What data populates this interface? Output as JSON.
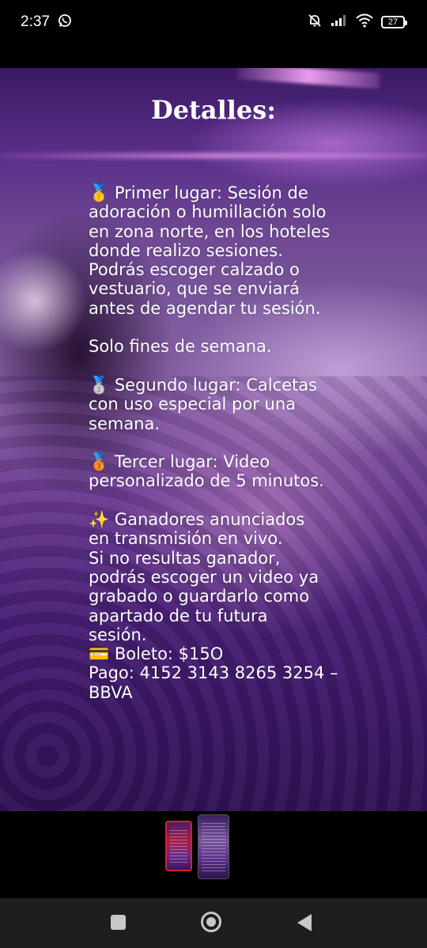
{
  "status_bar": {
    "time": "2:37",
    "battery_level": "27",
    "icons": [
      "whatsapp-icon",
      "bell-muted-icon",
      "signal-icon",
      "wifi-icon",
      "battery-icon"
    ]
  },
  "story": {
    "title": "Detalles:",
    "body": "🥇 Primer lugar: Sesión de\nadoración o humillación solo\nen zona norte, en los hoteles\ndonde realizo sesiones.\nPodrás escoger calzado o\nvestuario, que se enviará\nantes de agendar tu sesión.\n\n Solo fines de semana.\n\n🥈 Segundo lugar: Calcetas\ncon uso especial por una\nsemana.\n\n🥉 Tercer lugar: Video\npersonalizado de 5 minutos.\n\n✨ Ganadores anunciados\nen transmisión en vivo.\nSi no resultas ganador,\npodrás escoger un video ya\ngrabado o guardarlo como\napartado de tu futura\nsesión.\n💳 Boleto: $15O\nPago: 4152 3143 8265 3254 –\nBBVA"
  },
  "thumbnails": {
    "count": 2,
    "selected_index": 1
  },
  "nav_bar": {
    "icons": [
      "recents-icon",
      "home-icon",
      "back-icon"
    ]
  },
  "colors": {
    "accent_red": "#d2232f",
    "background": "#000000",
    "nav_background": "#1e1e1e"
  }
}
